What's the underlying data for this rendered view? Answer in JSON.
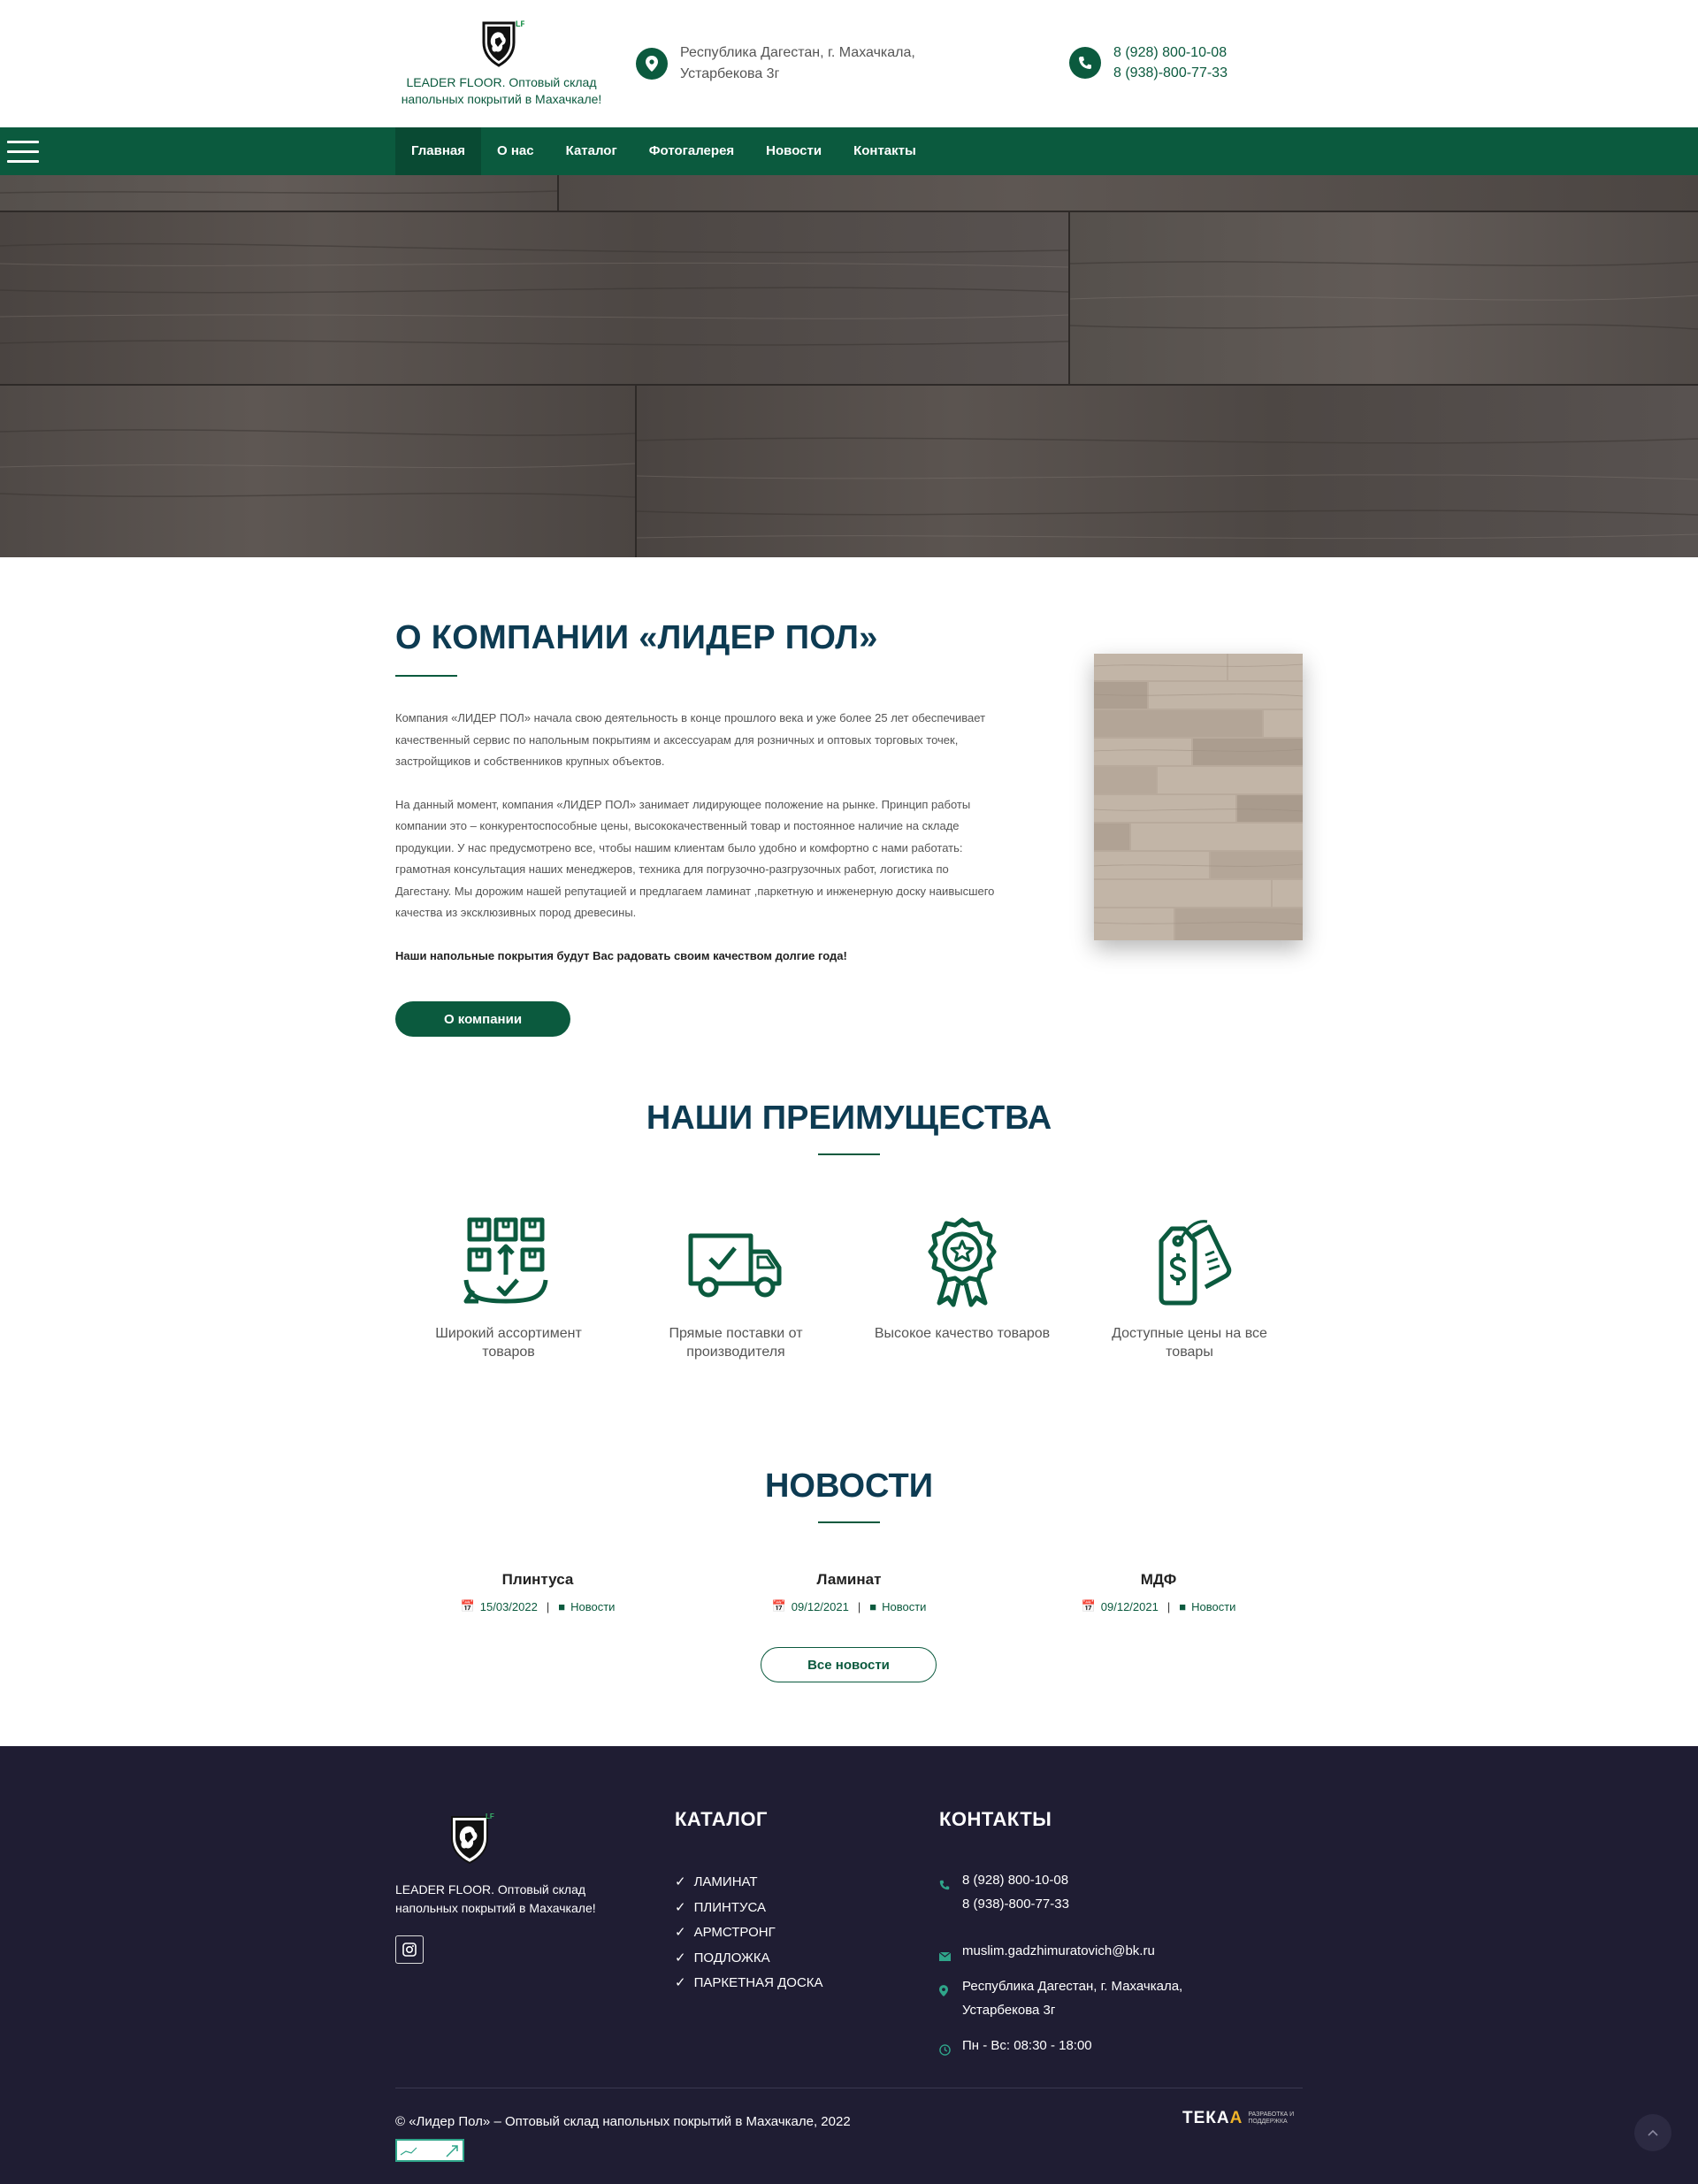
{
  "brand": {
    "name": "LEADER FLOOR. Оптовый склад напольных покрытий в Махачкале!",
    "mark": "LF",
    "primary_color": "#0b5a3e",
    "dark_color": "#1f1d33"
  },
  "header": {
    "address": "Республика Дагестан, г. Махачкала, Устарбекова 3г",
    "phones": [
      "8 (928) 800-10-08",
      "8 (938)-800-77-33"
    ],
    "icons": [
      "location-pin-icon",
      "phone-icon"
    ]
  },
  "nav": {
    "items": [
      {
        "label": "Главная",
        "active": true
      },
      {
        "label": "О нас",
        "active": false
      },
      {
        "label": "Каталог",
        "active": false
      },
      {
        "label": "Фотогалерея",
        "active": false
      },
      {
        "label": "Новости",
        "active": false
      },
      {
        "label": "Контакты",
        "active": false
      }
    ]
  },
  "about": {
    "title": "О КОМПАНИИ «ЛИДЕР ПОЛ»",
    "paragraphs": [
      "Компания «ЛИДЕР ПОЛ»  начала свою деятельность в конце прошлого века и уже более 25 лет обеспечивает качественный сервис по напольным покрытиям и аксессуарам для розничных и оптовых торговых точек, застройщиков и собственников крупных объектов.",
      "На данный момент, компания «ЛИДЕР ПОЛ» занимает лидирующее положение на рынке. Принцип работы компании это – конкурентоспособные цены, высококачественный товар и постоянное наличие на складе продукции. У нас предусмотрено все, чтобы нашим клиентам было удобно и комфортно с нами работать: грамотная консультация наших менеджеров, техника для погрузочно-разгрузочных работ, логистика по Дагестану. Мы дорожим нашей репутацией и предлагаем ламинат ,паркетную и инженерную доску наивысшего качества из эксклюзивных пород древесины."
    ],
    "highlight": "Наши напольные покрытия будут Вас радовать своим качеством долгие года!",
    "button_label": "О компании"
  },
  "advantages": {
    "title": "НАШИ ПРЕИМУЩЕСТВА",
    "items": [
      {
        "label": "Широкий ассортимент товаров",
        "icon": "boxes-icon"
      },
      {
        "label": "Прямые поставки от производителя",
        "icon": "truck-icon"
      },
      {
        "label": "Высокое качество товаров",
        "icon": "award-icon"
      },
      {
        "label": "Доступные цены на все товары",
        "icon": "price-tag-icon"
      }
    ]
  },
  "news": {
    "title": "НОВОСТИ",
    "items": [
      {
        "title": "Плинтуса",
        "date": "15/03/2022",
        "category": "Новости"
      },
      {
        "title": "Ламинат",
        "date": "09/12/2021",
        "category": "Новости"
      },
      {
        "title": "МДФ",
        "date": "09/12/2021",
        "category": "Новости"
      }
    ],
    "all_label": "Все новости"
  },
  "footer": {
    "logo_text": "LEADER FLOOR. Оптовый склад напольных покрытий в Махачкале!",
    "catalog_title": "КАТАЛОГ",
    "catalog_items": [
      "ЛАМИНАТ",
      "ПЛИНТУСА",
      "АРМСТРОНГ",
      "ПОДЛОЖКА",
      "ПАРКЕТНАЯ ДОСКА"
    ],
    "contacts_title": "КОНТАКТЫ",
    "phones": [
      "8 (928) 800-10-08",
      "8 (938)-800-77-33"
    ],
    "email": "muslim.gadzhimuratovich@bk.ru",
    "address": "Республика Дагестан, г. Махачкала, Устарбекова 3г",
    "hours": "Пн - Вс: 08:30 - 18:00",
    "copyright": "© «Лидер Пол» – Оптовый склад напольных покрытий в Махачкале, 2022",
    "developer": {
      "name": "ТЕКА",
      "name_accent": "А",
      "subtitle": "РАЗРАБОТКА И ПОДДЕРЖКА"
    }
  }
}
